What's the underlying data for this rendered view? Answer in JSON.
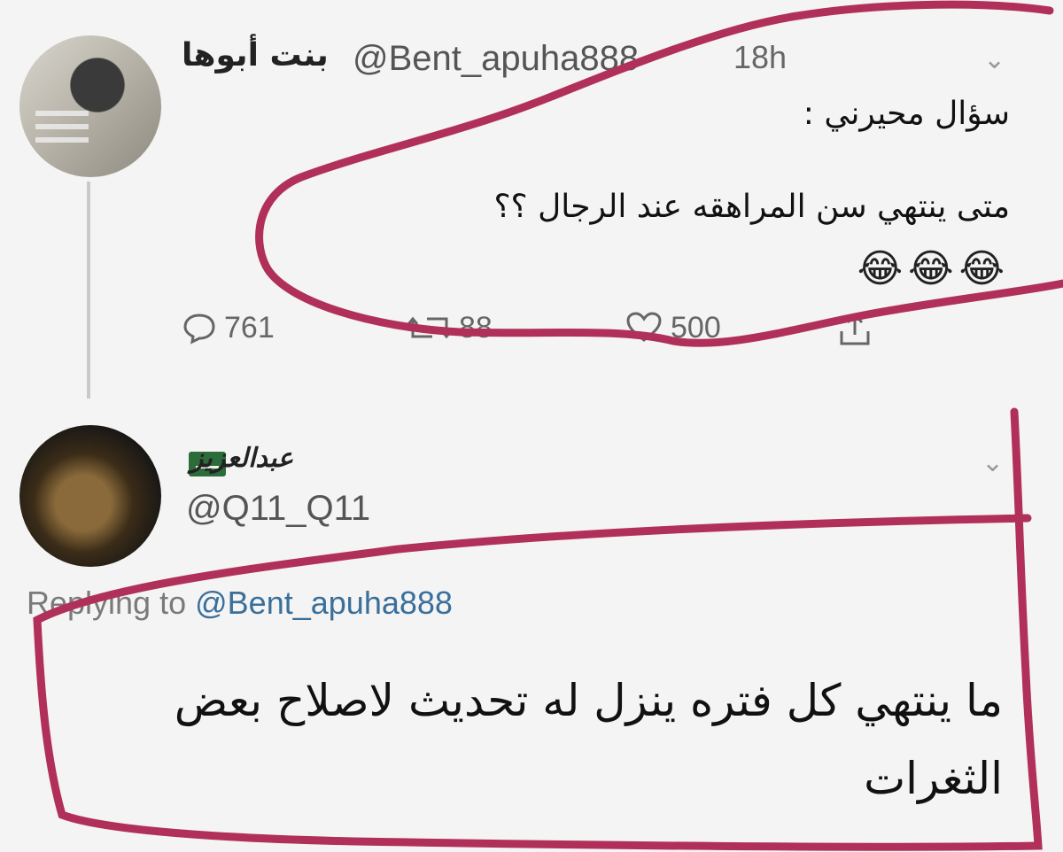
{
  "tweet1": {
    "author_name": "بنت أبوها",
    "handle": "@Bent_apuha888",
    "time": "18h",
    "text_line1": "سؤال محيرني :",
    "text_line2": "متى ينتهي سن المراهقه عند الرجال ؟؟",
    "emoji": "😂😂😂",
    "reply_count": "761",
    "retweet_count": "88",
    "like_count": "500"
  },
  "tweet2": {
    "author_name": "عبدالعزيز",
    "handle": "@Q11_Q11",
    "replying_prefix": "Replying to",
    "replying_mention": "@Bent_apuha888",
    "text_line1": "ما ينتهي كل فتره ينزل له تحديث لاصلاح بعض",
    "text_line2": "الثغرات"
  },
  "icons": {
    "reply": "reply-icon",
    "retweet": "retweet-icon",
    "like": "heart-icon",
    "share": "share-icon",
    "chevron": "chevron-down-icon",
    "flag": "saudi-flag-icon"
  },
  "colors": {
    "annotation_stroke": "#b0305a",
    "mention": "#3a6f9a",
    "background": "#f4f4f4"
  }
}
